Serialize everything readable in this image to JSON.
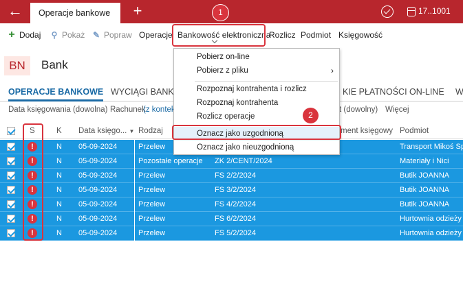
{
  "titlebar": {
    "back_icon": "arrow-left-icon",
    "active_tab": "Operacje bankowe",
    "new_tab_icon": "plus-icon",
    "company_id": "17..1001"
  },
  "toolbar": {
    "add": "Dodaj",
    "show": "Pokaż",
    "edit": "Popraw",
    "operations": "Operacje",
    "e_banking": "Bankowość elektroniczna",
    "settle": "Rozlicz",
    "subject": "Podmiot",
    "accounting": "Księgowość"
  },
  "header": {
    "badge": "BN",
    "title": "Bank"
  },
  "tabs": {
    "t1": "OPERACJE BANKOWE",
    "t2": "WYCIĄGI BANKO",
    "t3": "KIE PŁATNOŚCI ON-LINE",
    "t4": "W"
  },
  "filters": {
    "date": "Data księgowania (dowolna)",
    "account_label": "Rachunek",
    "account_link": "(z kontek",
    "any": "t (dowolny)",
    "more": "Więcej"
  },
  "table": {
    "headers": {
      "s": "S",
      "k": "K",
      "date": "Data księgo...",
      "type": "Rodzaj",
      "document": "ment księgowy",
      "subject": "Podmiot"
    },
    "rows": [
      {
        "k": "N",
        "date": "05-09-2024",
        "type": "Przelew",
        "doc": "",
        "subject": "Transport Mikoś Sp"
      },
      {
        "k": "N",
        "date": "05-09-2024",
        "type": "Pozostałe operacje",
        "doc": "ZK 2/CENT/2024",
        "subject": "Materiały i Nici"
      },
      {
        "k": "N",
        "date": "05-09-2024",
        "type": "Przelew",
        "doc": "FS 2/2/2024",
        "subject": "Butik JOANNA"
      },
      {
        "k": "N",
        "date": "05-09-2024",
        "type": "Przelew",
        "doc": "FS 3/2/2024",
        "subject": "Butik JOANNA"
      },
      {
        "k": "N",
        "date": "05-09-2024",
        "type": "Przelew",
        "doc": "FS 4/2/2024",
        "subject": "Butik JOANNA"
      },
      {
        "k": "N",
        "date": "05-09-2024",
        "type": "Przelew",
        "doc": "FS 6/2/2024",
        "subject": "Hurtownia odzieży"
      },
      {
        "k": "N",
        "date": "05-09-2024",
        "type": "Przelew",
        "doc": "FS 5/2/2024",
        "subject": "Hurtownia odzieży"
      }
    ]
  },
  "dropdown": {
    "i1": "Pobierz on-line",
    "i2": "Pobierz z pliku",
    "i3": "Rozpoznaj kontrahenta i rozlicz",
    "i4": "Rozpoznaj kontrahenta",
    "i5": "Rozlicz operacje",
    "i6": "Oznacz jako uzgodnioną",
    "i7": "Oznacz jako nieuzgodnioną"
  },
  "callouts": {
    "one": "1",
    "two": "2"
  },
  "colors": {
    "brand": "#b8262d",
    "selection": "#1b98e0",
    "callout": "#d9343d",
    "tab_active": "#1a6aa5"
  }
}
